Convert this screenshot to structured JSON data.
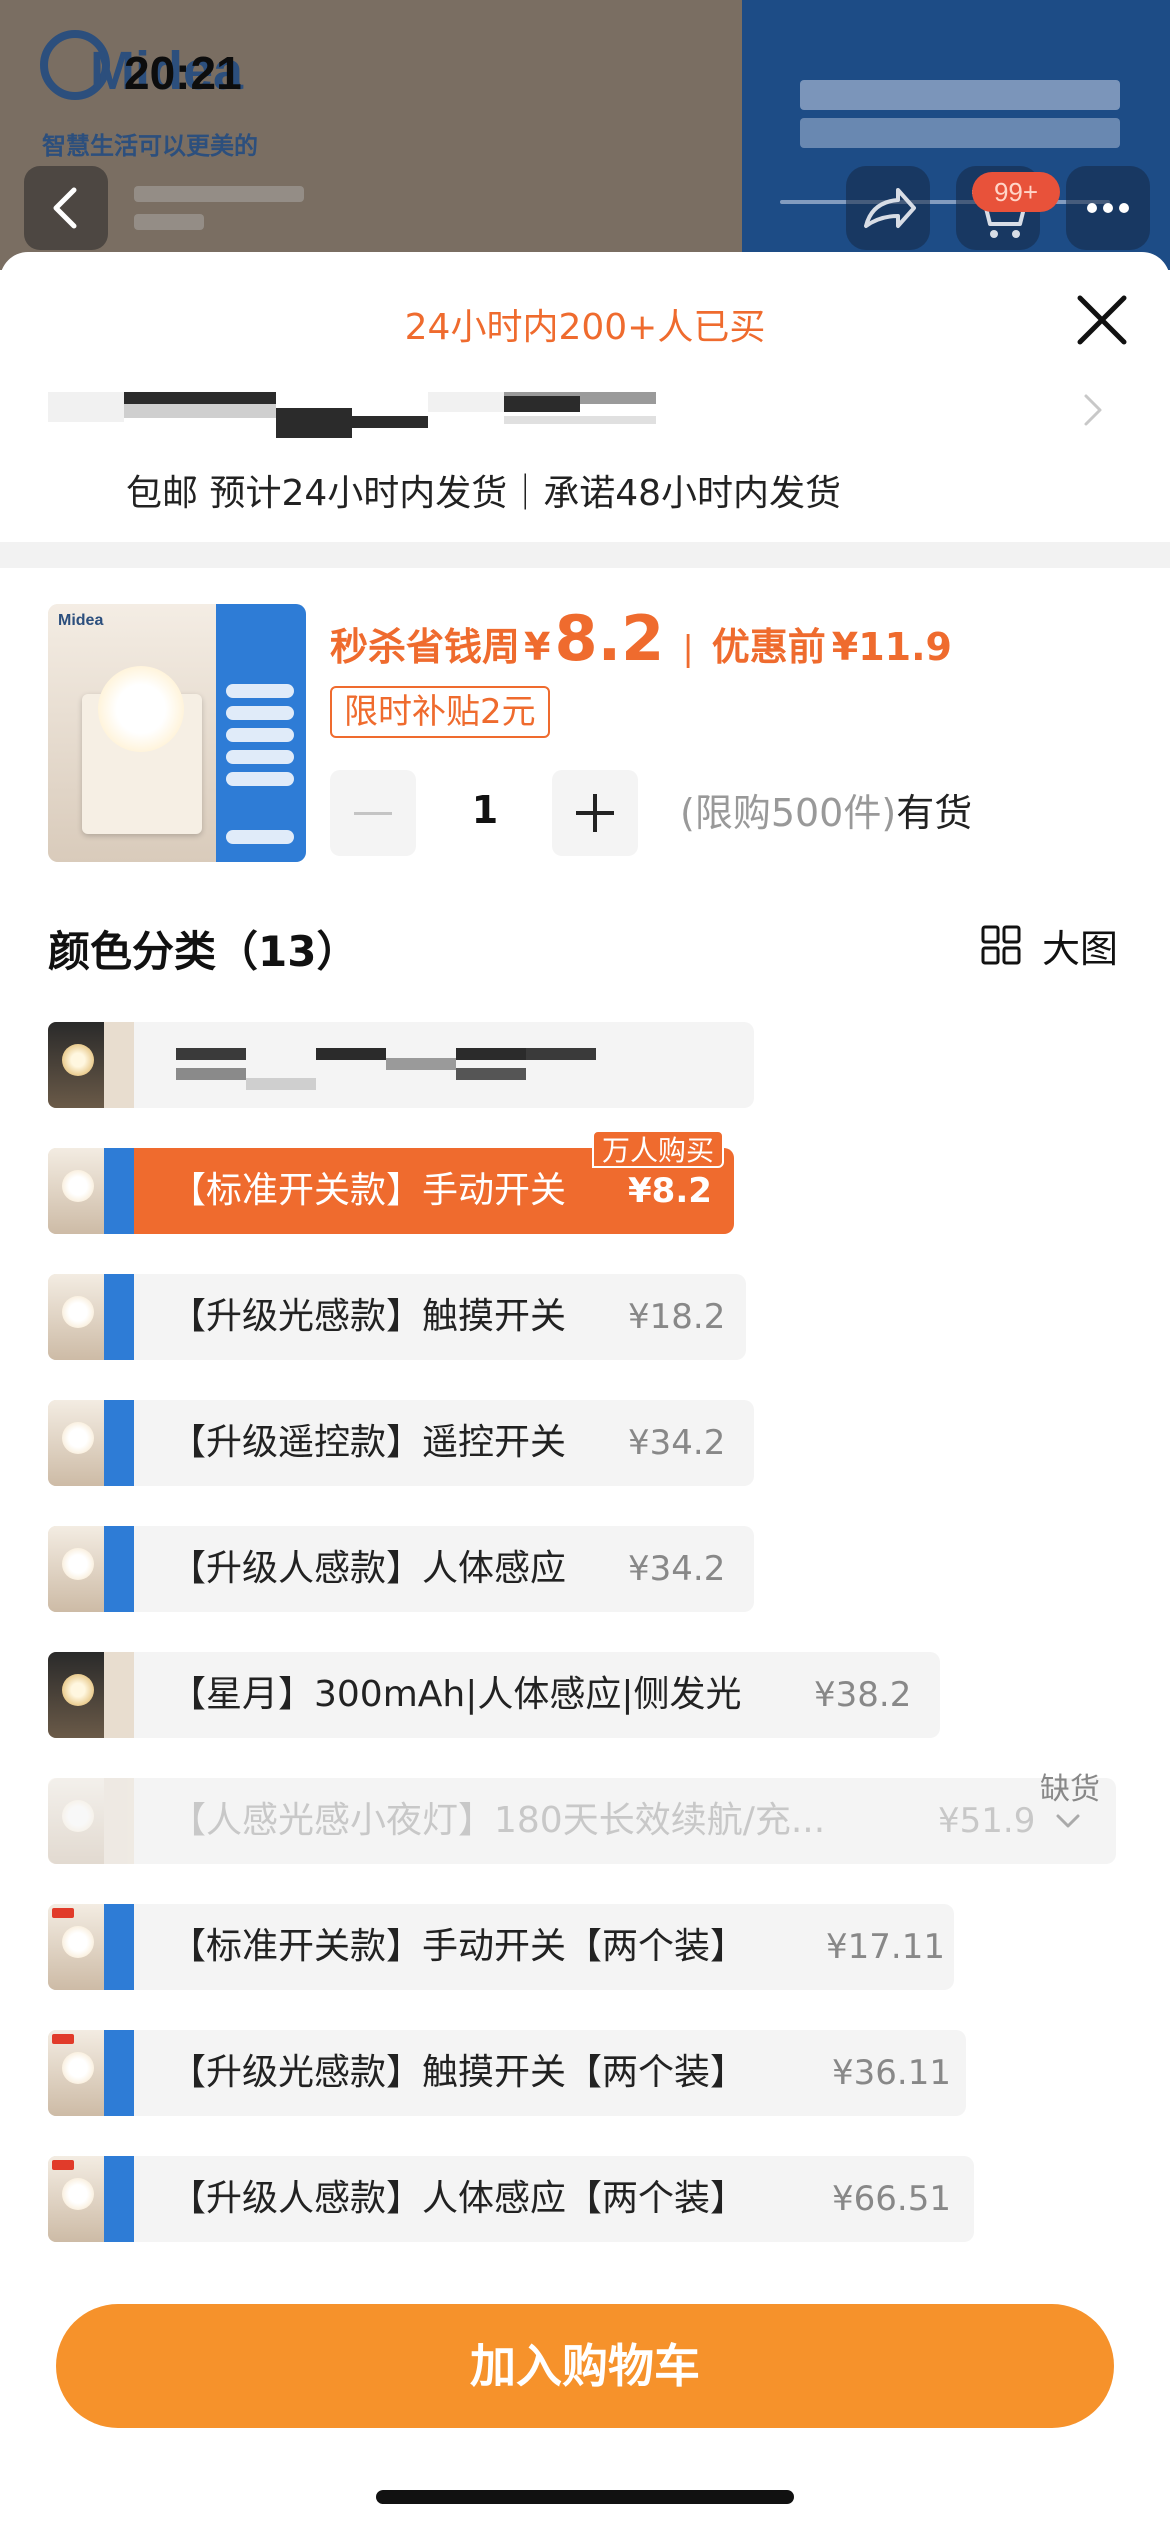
{
  "status_bar": {
    "time": "20:21"
  },
  "background_page": {
    "brand_logo_text": "Midea",
    "slogan": "智慧生活可以更美的",
    "cart_badge": "99+"
  },
  "sheet": {
    "sold_banner": "24小时内200+人已买",
    "shipping": "包邮 预计24小时内发货｜承诺48小时内发货",
    "product": {
      "thumb_brand": "Midea",
      "price_label": "秒杀省钱周",
      "currency": "¥",
      "price": "8.2",
      "separator": "|",
      "original_label": "优惠前",
      "original_price": "¥11.9",
      "subsidy": "限时补贴2元"
    },
    "quantity": {
      "value": "1",
      "limit": "(限购500件)",
      "stock": "有货"
    },
    "variants": {
      "title": "颜色分类（13）",
      "big_view_label": "大图",
      "hot_tag": "万人购买",
      "oos_tag": "缺货",
      "options": [
        {
          "label": "",
          "price": ""
        },
        {
          "label": "【标准开关款】手动开关",
          "price": "¥8.2"
        },
        {
          "label": "【升级光感款】触摸开关",
          "price": "¥18.2"
        },
        {
          "label": "【升级遥控款】遥控开关",
          "price": "¥34.2"
        },
        {
          "label": "【升级人感款】人体感应",
          "price": "¥34.2"
        },
        {
          "label": "【星月】300mAh|人体感应|侧发光",
          "price": "¥38.2"
        },
        {
          "label": "【人感光感小夜灯】180天长效续航/充...",
          "price": "¥51.9"
        },
        {
          "label": "【标准开关款】手动开关【两个装】",
          "price": "¥17.11"
        },
        {
          "label": "【升级光感款】触摸开关【两个装】",
          "price": "¥36.11"
        },
        {
          "label": "【升级人感款】人体感应【两个装】",
          "price": "¥66.51"
        }
      ]
    },
    "cart_button": "加入购物车"
  },
  "colors": {
    "accent": "#ef6b2e",
    "cart": "#f6922b"
  }
}
